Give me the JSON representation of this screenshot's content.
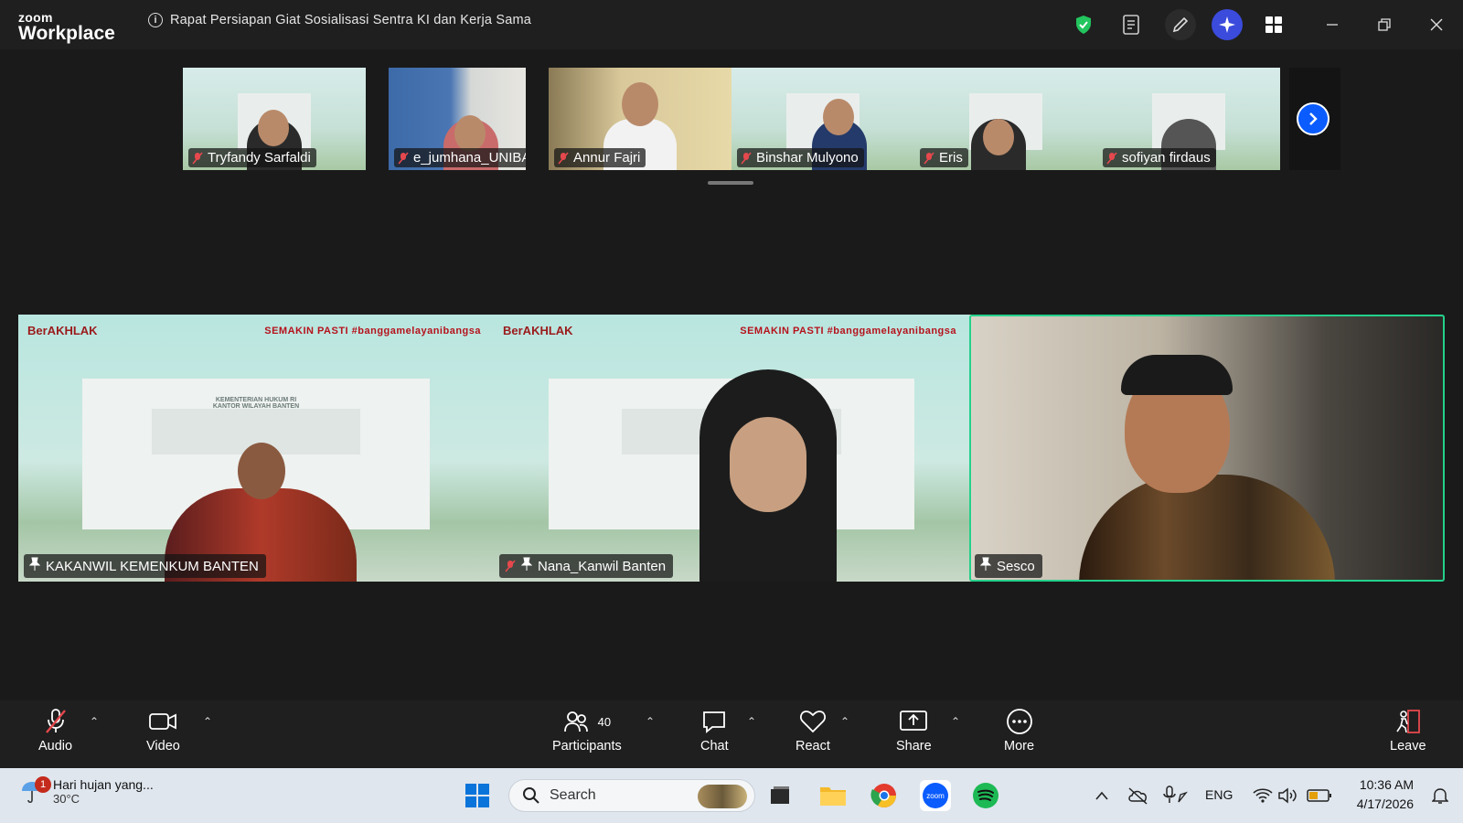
{
  "app": {
    "brand_top": "zoom",
    "brand_bottom": "Workplace"
  },
  "meeting": {
    "title": "Rapat Persiapan Giat Sosialisasi Sentra KI dan Kerja Sama"
  },
  "strip": {
    "participants": [
      {
        "name": "Tryfandy Sarfaldi"
      },
      {
        "name": "e_jumhana_UNIBA"
      },
      {
        "name": "Annur Fajri"
      },
      {
        "name": "Binshar Mulyono"
      },
      {
        "name": "Eris"
      },
      {
        "name": "sofiyan firdaus"
      }
    ]
  },
  "tiles": [
    {
      "name": "KAKANWIL KEMENKUM BANTEN",
      "brand": "BerAKHLAK",
      "brand_right": "SEMAKIN PASTI #banggamelayanibangsa",
      "building_sign": "KEMENTERIAN HUKUM RI\nKANTOR WILAYAH BANTEN"
    },
    {
      "name": "Nana_Kanwil Banten",
      "brand": "BerAKHLAK",
      "brand_right": "SEMAKIN PASTI #banggamelayanibangsa"
    },
    {
      "name": "Sesco",
      "active_speaker": true
    }
  ],
  "toolbar": {
    "audio": "Audio",
    "video": "Video",
    "participants": "Participants",
    "participants_count": "40",
    "chat": "Chat",
    "react": "React",
    "share": "Share",
    "more": "More",
    "leave": "Leave"
  },
  "taskbar": {
    "weather_text": "Hari hujan yang...",
    "weather_temp": "30°C",
    "notification_count": "1",
    "search_label": "Search",
    "language": "ENG",
    "time": "10:36 AM",
    "date": "4/17/2026"
  },
  "colors": {
    "accent": "#0b5cff",
    "active_border": "#23d18b",
    "toolbar_bg": "#1f1f1f",
    "stage_bg": "#1a1a1a"
  }
}
